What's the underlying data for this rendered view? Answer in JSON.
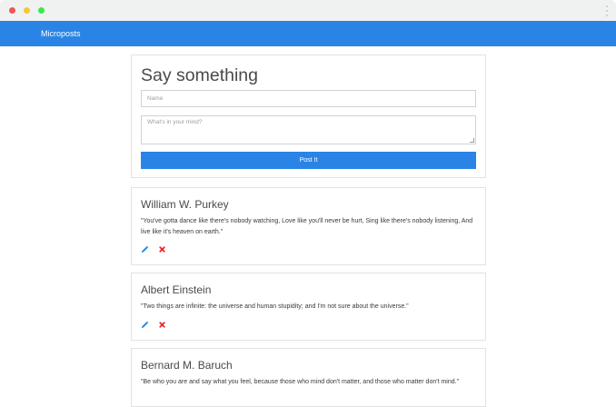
{
  "navbar": {
    "brand": "Microposts"
  },
  "compose": {
    "title": "Say something",
    "name_placeholder": "Name",
    "message_placeholder": "What's in your mind?",
    "submit_label": "Post It"
  },
  "posts": [
    {
      "author": "William W. Purkey",
      "quote": "\"You've gotta dance like there's nobody watching, Love like you'll never be hurt, Sing like there's nobody listening, And live like it's heaven on earth.\""
    },
    {
      "author": "Albert Einstein",
      "quote": "\"Two things are infinite: the universe and human stupidity; and I'm not sure about the universe.\""
    },
    {
      "author": "Bernard M. Baruch",
      "quote": "\"Be who you are and say what you feel, because those who mind don't matter, and those who matter don't mind.\""
    }
  ],
  "colors": {
    "accent": "#2a84e6",
    "edit_icon": "#2a84e6",
    "delete_icon": "#e8262b"
  },
  "icons": {
    "edit": "pencil-icon",
    "delete": "close-icon"
  }
}
